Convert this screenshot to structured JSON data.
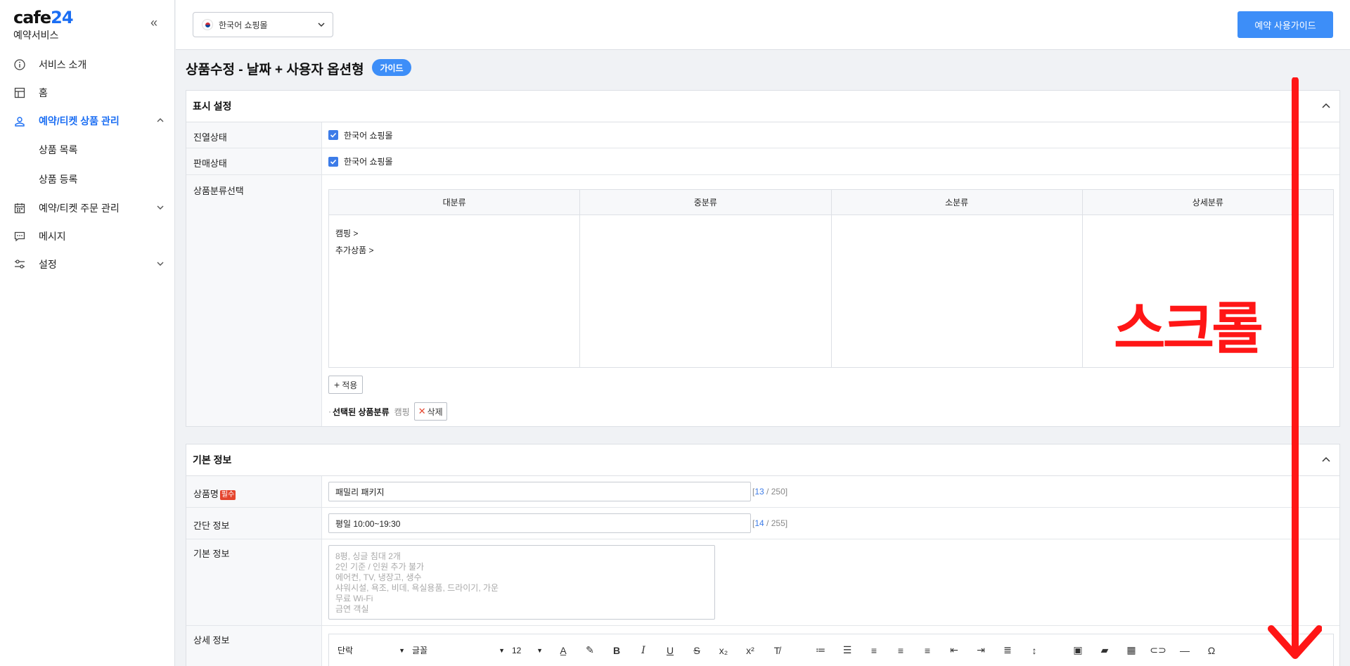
{
  "sidebar": {
    "logo_main": "cafe",
    "logo_num": "24",
    "logo_sub": "예약서비스",
    "items": [
      {
        "label": "서비스 소개"
      },
      {
        "label": "홈"
      },
      {
        "label": "예약/티켓 상품 관리"
      },
      {
        "label": "예약/티켓 주문 관리"
      },
      {
        "label": "메시지"
      },
      {
        "label": "설정"
      }
    ],
    "sub_items": [
      {
        "label": "상품 목록"
      },
      {
        "label": "상품 등록"
      }
    ]
  },
  "topbar": {
    "mall_selected": "한국어 쇼핑몰",
    "guide_button": "예약 사용가이드"
  },
  "page": {
    "title": "상품수정 - 날짜 + 사용자 옵션형",
    "guide_badge": "가이드"
  },
  "display_settings": {
    "heading": "표시 설정",
    "display_status_label": "진열상태",
    "display_status_value": "한국어 쇼핑몰",
    "sale_status_label": "판매상태",
    "sale_status_value": "한국어 쇼핑몰",
    "category_label": "상품분류선택",
    "category_headers": [
      "대분류",
      "중분류",
      "소분류",
      "상세분류"
    ],
    "category_items": [
      "캠핑 >",
      "추가상품 >"
    ],
    "apply_button": "적용",
    "selected_label": "선택된 상품분류",
    "selected_value": "캠핑",
    "delete_button": "삭제"
  },
  "basic_info": {
    "heading": "기본 정보",
    "name_label": "상품명",
    "required_badge": "필수",
    "name_value": "패밀리 패키지",
    "name_count": "13",
    "name_max": "250",
    "summary_label": "간단 정보",
    "summary_value": "평일 10:00~19:30",
    "summary_count": "14",
    "summary_max": "255",
    "basic_label": "기본 정보",
    "basic_placeholder_lines": [
      "8평, 싱글 침대 2개",
      "2인 기준 / 인원 추가 불가",
      "에어컨, TV, 냉장고, 생수",
      "샤워시설, 욕조, 비데, 욕실용품, 드라이기, 가운",
      "무료 Wi-Fi",
      "금연 객실"
    ],
    "detail_label": "상세 정보",
    "editor": {
      "paragraph_select": "단락",
      "font_select": "글꼴",
      "size_select": "12"
    }
  },
  "overlay": {
    "scroll_text": "스크롤",
    "color": "#ff1616"
  },
  "colors": {
    "accent": "#3d8ef8",
    "active_nav": "#1b6ef3",
    "required": "#e5452e"
  }
}
